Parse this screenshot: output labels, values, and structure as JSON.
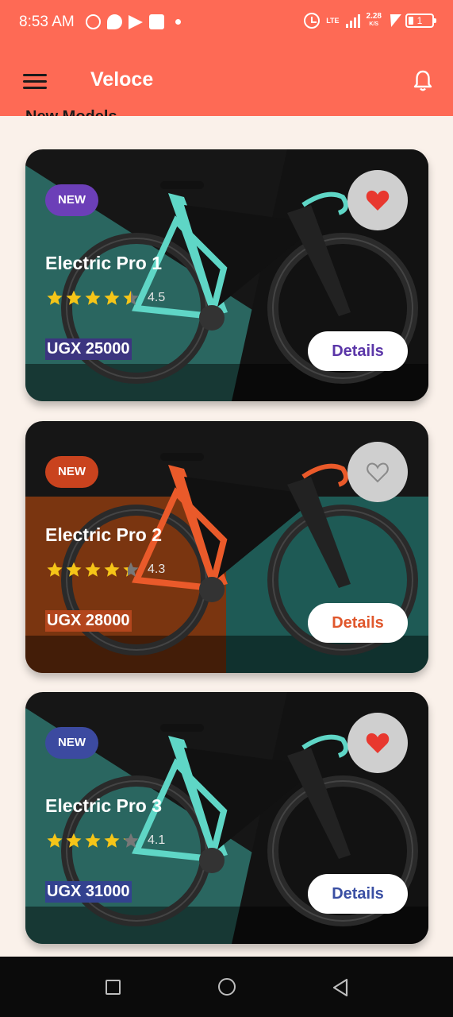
{
  "status_bar": {
    "time": "8:53 AM",
    "network": "LTE",
    "speed_value": "2.28",
    "speed_unit": "K/S",
    "battery": "1"
  },
  "app_bar": {
    "title": "Veloce",
    "menu_icon": "hamburger-menu-icon",
    "bell_icon": "bell-icon"
  },
  "section": {
    "title": "New Models"
  },
  "products": [
    {
      "badge": "NEW",
      "badge_color": "#6c3fb8",
      "name": "Electric Pro 1",
      "rating": "4.5",
      "rating_value": 4.5,
      "price": "UGX 25000",
      "price_bg": "#3c3580",
      "favorite": true,
      "details_label": "Details",
      "details_color": "#5b36a8",
      "theme": "teal"
    },
    {
      "badge": "NEW",
      "badge_color": "#c9431e",
      "name": "Electric Pro 2",
      "rating": "4.3",
      "rating_value": 4.3,
      "price": "UGX 28000",
      "price_bg": "#b3461d",
      "favorite": false,
      "details_label": "Details",
      "details_color": "#e0572c",
      "theme": "orange"
    },
    {
      "badge": "NEW",
      "badge_color": "#3c4aa0",
      "name": "Electric Pro 3",
      "rating": "4.1",
      "rating_value": 4.1,
      "price": "UGX 31000",
      "price_bg": "#33428f",
      "favorite": true,
      "details_label": "Details",
      "details_color": "#3a4fa3",
      "theme": "teal"
    }
  ],
  "colors": {
    "app_bar": "#fe6a55",
    "background": "#faf1ea",
    "favorite_heart": "#e8382f"
  },
  "nav_bar": {
    "recent_icon": "square-recent-apps-icon",
    "home_icon": "circle-home-icon",
    "back_icon": "triangle-back-icon"
  }
}
